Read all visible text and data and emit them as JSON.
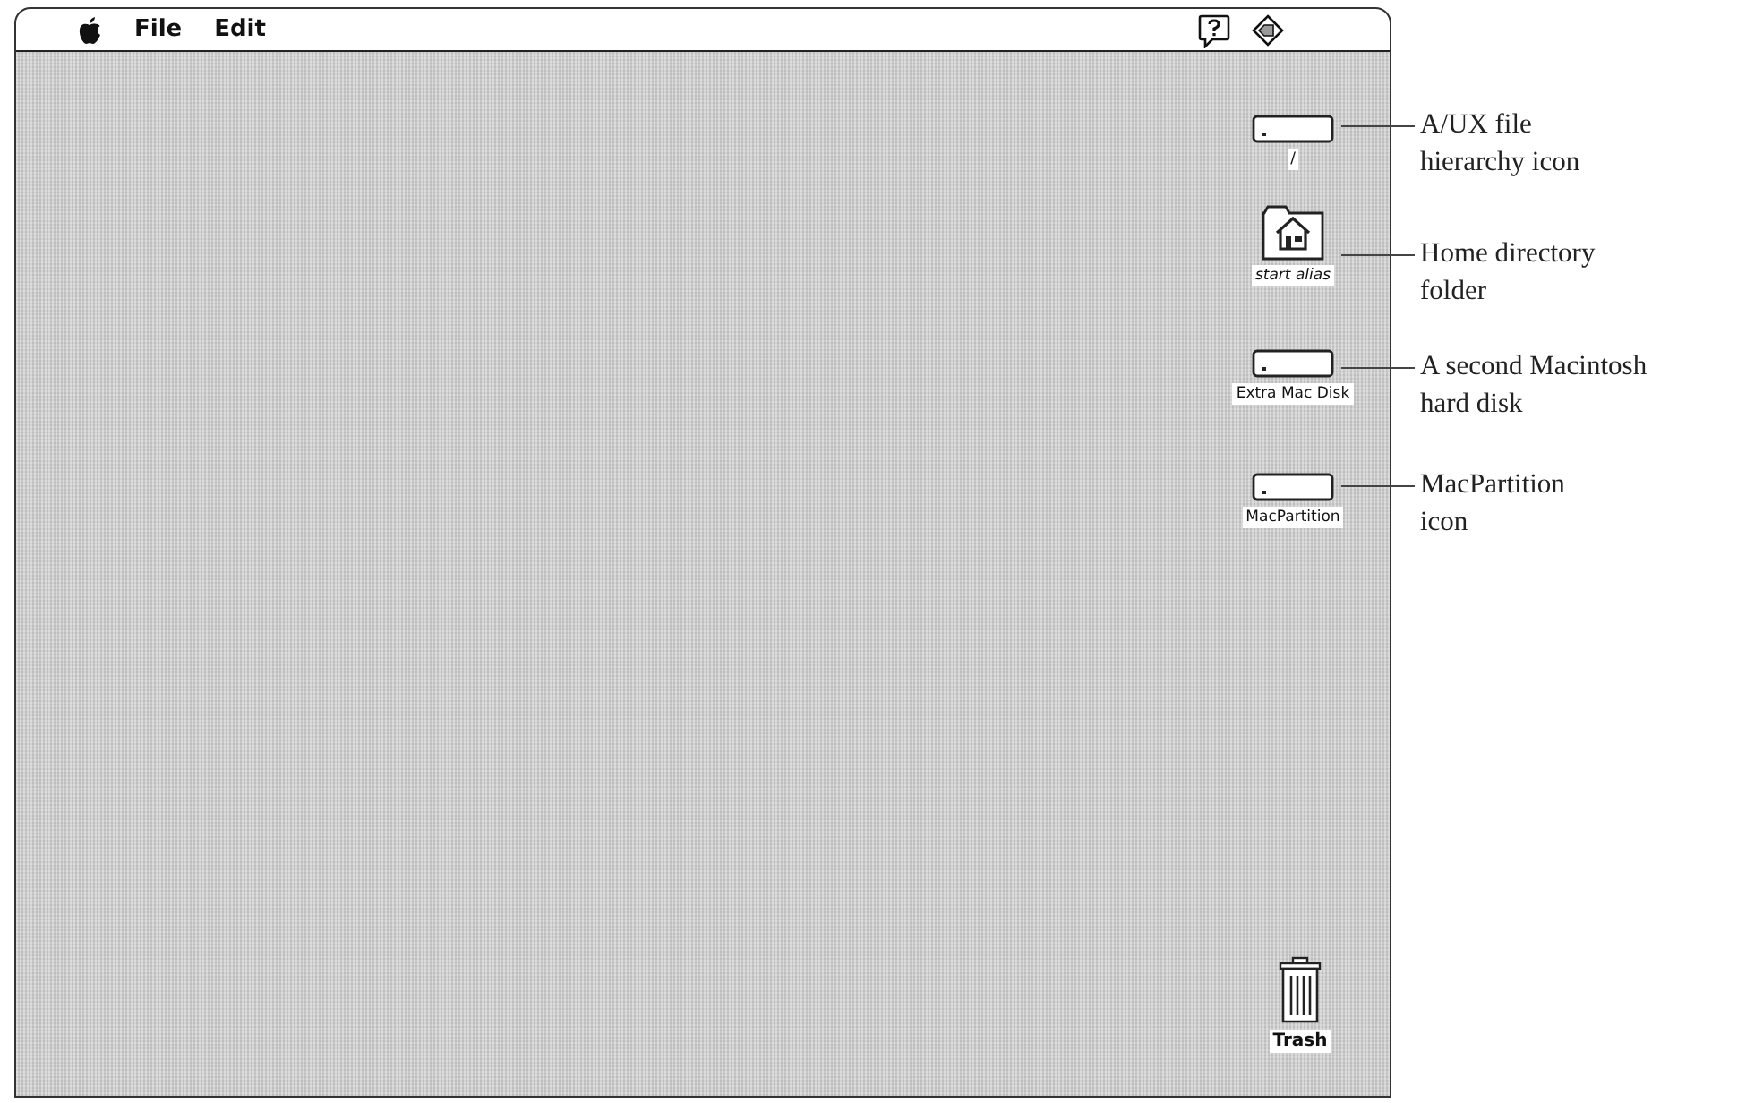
{
  "menu_bar": {
    "items": [
      {
        "label": "File"
      },
      {
        "label": "Edit"
      }
    ]
  },
  "desktop_icons": [
    {
      "kind": "disk",
      "label": "/",
      "alias": false
    },
    {
      "kind": "folder",
      "label": "start alias",
      "alias": true
    },
    {
      "kind": "disk",
      "label": "Extra Mac Disk",
      "alias": false
    },
    {
      "kind": "disk",
      "label": "MacPartition",
      "alias": false
    },
    {
      "kind": "trash",
      "label": "Trash",
      "alias": false
    }
  ],
  "callouts": [
    {
      "lines": [
        "A/UX file",
        "hierarchy icon"
      ]
    },
    {
      "lines": [
        "Home directory",
        "folder"
      ]
    },
    {
      "lines": [
        "A second Macintosh",
        "hard disk"
      ]
    },
    {
      "lines": [
        "MacPartition",
        "icon"
      ]
    }
  ]
}
